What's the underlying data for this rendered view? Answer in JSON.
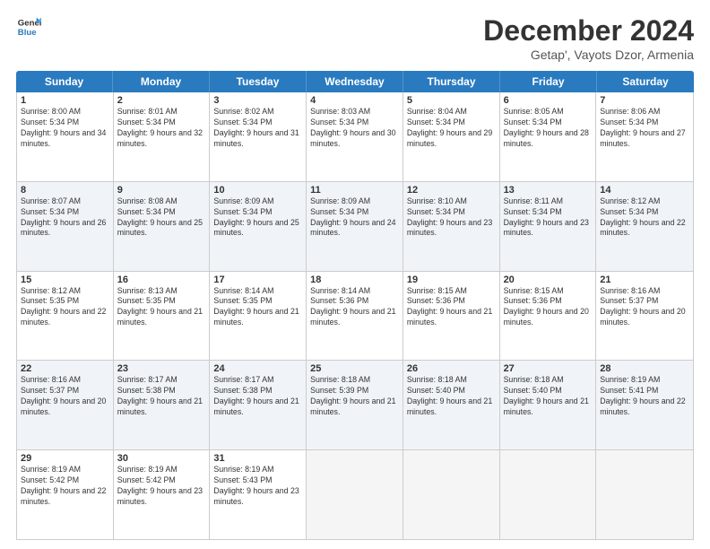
{
  "logo": {
    "general": "General",
    "blue": "Blue"
  },
  "title": "December 2024",
  "subtitle": "Getap', Vayots Dzor, Armenia",
  "days": [
    "Sunday",
    "Monday",
    "Tuesday",
    "Wednesday",
    "Thursday",
    "Friday",
    "Saturday"
  ],
  "weeks": [
    [
      {
        "day": "1",
        "rise": "8:00 AM",
        "set": "5:34 PM",
        "daylight": "9 hours and 34 minutes."
      },
      {
        "day": "2",
        "rise": "8:01 AM",
        "set": "5:34 PM",
        "daylight": "9 hours and 32 minutes."
      },
      {
        "day": "3",
        "rise": "8:02 AM",
        "set": "5:34 PM",
        "daylight": "9 hours and 31 minutes."
      },
      {
        "day": "4",
        "rise": "8:03 AM",
        "set": "5:34 PM",
        "daylight": "9 hours and 30 minutes."
      },
      {
        "day": "5",
        "rise": "8:04 AM",
        "set": "5:34 PM",
        "daylight": "9 hours and 29 minutes."
      },
      {
        "day": "6",
        "rise": "8:05 AM",
        "set": "5:34 PM",
        "daylight": "9 hours and 28 minutes."
      },
      {
        "day": "7",
        "rise": "8:06 AM",
        "set": "5:34 PM",
        "daylight": "9 hours and 27 minutes."
      }
    ],
    [
      {
        "day": "8",
        "rise": "8:07 AM",
        "set": "5:34 PM",
        "daylight": "9 hours and 26 minutes."
      },
      {
        "day": "9",
        "rise": "8:08 AM",
        "set": "5:34 PM",
        "daylight": "9 hours and 25 minutes."
      },
      {
        "day": "10",
        "rise": "8:09 AM",
        "set": "5:34 PM",
        "daylight": "9 hours and 25 minutes."
      },
      {
        "day": "11",
        "rise": "8:09 AM",
        "set": "5:34 PM",
        "daylight": "9 hours and 24 minutes."
      },
      {
        "day": "12",
        "rise": "8:10 AM",
        "set": "5:34 PM",
        "daylight": "9 hours and 23 minutes."
      },
      {
        "day": "13",
        "rise": "8:11 AM",
        "set": "5:34 PM",
        "daylight": "9 hours and 23 minutes."
      },
      {
        "day": "14",
        "rise": "8:12 AM",
        "set": "5:34 PM",
        "daylight": "9 hours and 22 minutes."
      }
    ],
    [
      {
        "day": "15",
        "rise": "8:12 AM",
        "set": "5:35 PM",
        "daylight": "9 hours and 22 minutes."
      },
      {
        "day": "16",
        "rise": "8:13 AM",
        "set": "5:35 PM",
        "daylight": "9 hours and 21 minutes."
      },
      {
        "day": "17",
        "rise": "8:14 AM",
        "set": "5:35 PM",
        "daylight": "9 hours and 21 minutes."
      },
      {
        "day": "18",
        "rise": "8:14 AM",
        "set": "5:36 PM",
        "daylight": "9 hours and 21 minutes."
      },
      {
        "day": "19",
        "rise": "8:15 AM",
        "set": "5:36 PM",
        "daylight": "9 hours and 21 minutes."
      },
      {
        "day": "20",
        "rise": "8:15 AM",
        "set": "5:36 PM",
        "daylight": "9 hours and 20 minutes."
      },
      {
        "day": "21",
        "rise": "8:16 AM",
        "set": "5:37 PM",
        "daylight": "9 hours and 20 minutes."
      }
    ],
    [
      {
        "day": "22",
        "rise": "8:16 AM",
        "set": "5:37 PM",
        "daylight": "9 hours and 20 minutes."
      },
      {
        "day": "23",
        "rise": "8:17 AM",
        "set": "5:38 PM",
        "daylight": "9 hours and 21 minutes."
      },
      {
        "day": "24",
        "rise": "8:17 AM",
        "set": "5:38 PM",
        "daylight": "9 hours and 21 minutes."
      },
      {
        "day": "25",
        "rise": "8:18 AM",
        "set": "5:39 PM",
        "daylight": "9 hours and 21 minutes."
      },
      {
        "day": "26",
        "rise": "8:18 AM",
        "set": "5:40 PM",
        "daylight": "9 hours and 21 minutes."
      },
      {
        "day": "27",
        "rise": "8:18 AM",
        "set": "5:40 PM",
        "daylight": "9 hours and 21 minutes."
      },
      {
        "day": "28",
        "rise": "8:19 AM",
        "set": "5:41 PM",
        "daylight": "9 hours and 22 minutes."
      }
    ],
    [
      {
        "day": "29",
        "rise": "8:19 AM",
        "set": "5:42 PM",
        "daylight": "9 hours and 22 minutes."
      },
      {
        "day": "30",
        "rise": "8:19 AM",
        "set": "5:42 PM",
        "daylight": "9 hours and 23 minutes."
      },
      {
        "day": "31",
        "rise": "8:19 AM",
        "set": "5:43 PM",
        "daylight": "9 hours and 23 minutes."
      },
      null,
      null,
      null,
      null
    ]
  ],
  "altRows": [
    1,
    3
  ]
}
